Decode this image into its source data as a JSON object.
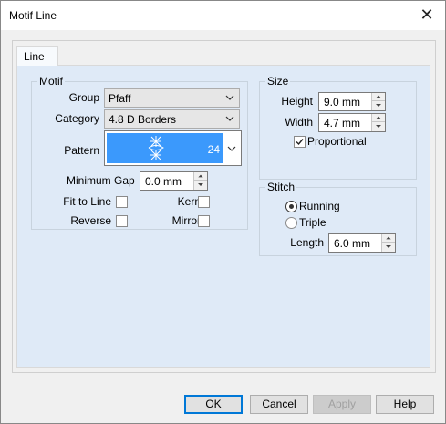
{
  "window": {
    "title": "Motif Line"
  },
  "tabs": [
    {
      "label": "Line"
    }
  ],
  "motif": {
    "group_title": "Motif",
    "group_label": "Group",
    "group_value": "Pfaff",
    "category_label": "Category",
    "category_value": "4.8 D Borders",
    "pattern_label": "Pattern",
    "pattern_number": "24",
    "min_gap_label": "Minimum Gap",
    "min_gap_value": "0.0 mm",
    "fit_to_line_label": "Fit to Line",
    "fit_to_line_checked": false,
    "kern_label": "Kern",
    "kern_checked": false,
    "reverse_label": "Reverse",
    "reverse_checked": false,
    "mirror_label": "Mirror",
    "mirror_checked": false
  },
  "size": {
    "group_title": "Size",
    "height_label": "Height",
    "height_value": "9.0 mm",
    "width_label": "Width",
    "width_value": "4.7 mm",
    "proportional_label": "Proportional",
    "proportional_checked": true
  },
  "stitch": {
    "group_title": "Stitch",
    "running_label": "Running",
    "triple_label": "Triple",
    "selected": "Running",
    "length_label": "Length",
    "length_value": "6.0 mm"
  },
  "buttons": {
    "ok": "OK",
    "cancel": "Cancel",
    "apply": "Apply",
    "help": "Help"
  },
  "colors": {
    "selection": "#3b99fc",
    "panel": "#dfeaf7",
    "default_button_border": "#0078d7"
  }
}
